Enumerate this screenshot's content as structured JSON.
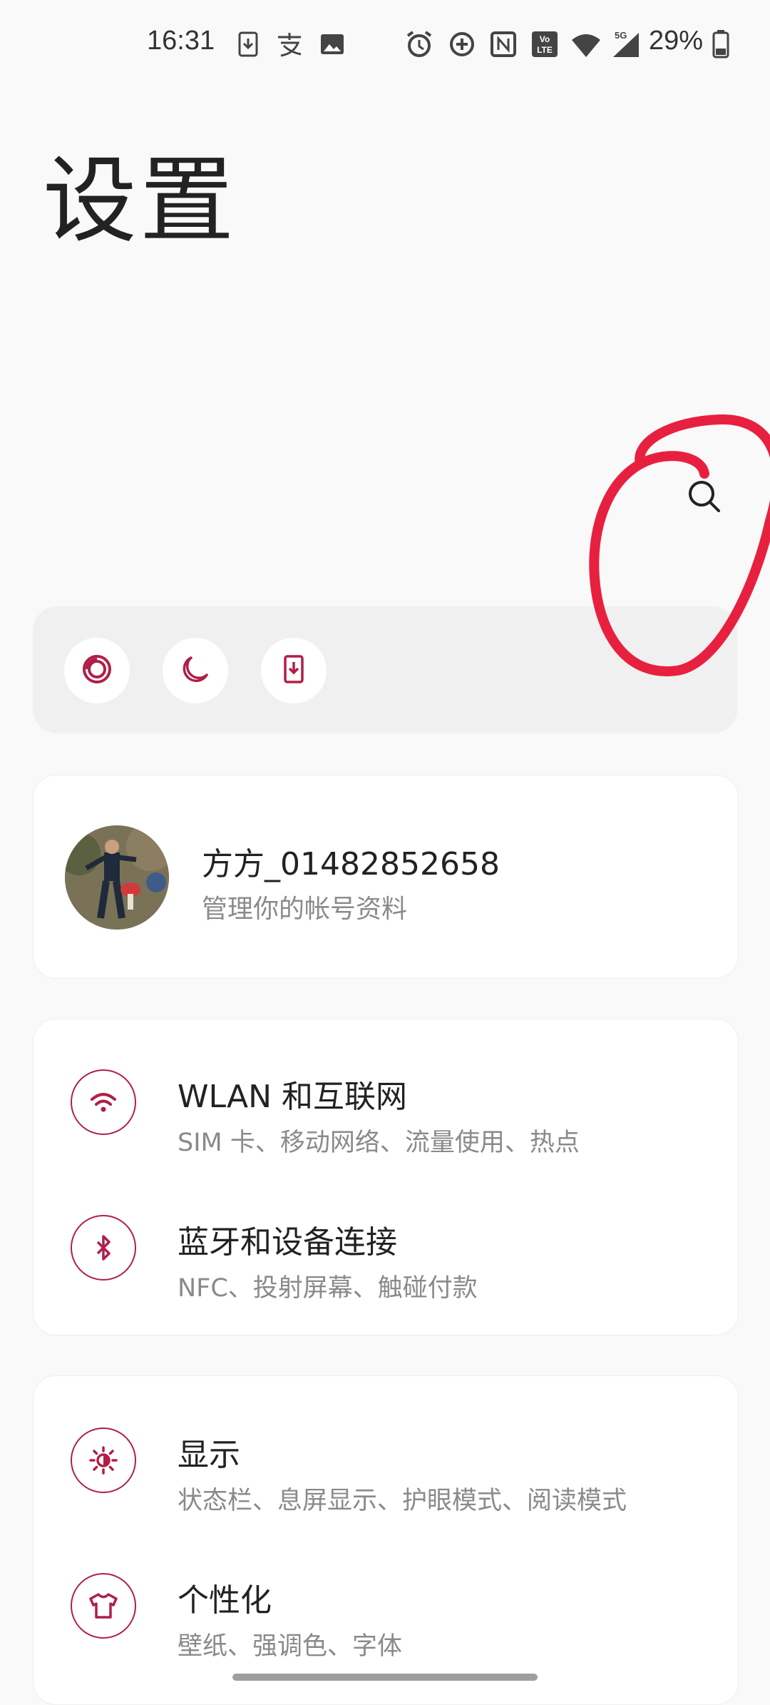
{
  "status_bar": {
    "time": "16:31",
    "battery": "29%",
    "network": "5G",
    "left_icons": [
      "download-icon",
      "alipay-icon",
      "image-icon"
    ],
    "right_icons": [
      "alarm-icon",
      "data-saver-icon",
      "nfc-icon",
      "volte-icon",
      "wifi-icon",
      "signal-icon",
      "battery-icon"
    ]
  },
  "header": {
    "title": "设置"
  },
  "search": {
    "icon": "search-icon"
  },
  "quick_actions": [
    {
      "icon": "screen-record-icon"
    },
    {
      "icon": "night-mode-icon"
    },
    {
      "icon": "phone-download-icon"
    }
  ],
  "account": {
    "name": "方方_01482852658",
    "subtitle": "管理你的帐号资料"
  },
  "groups": [
    {
      "items": [
        {
          "title": "WLAN 和互联网",
          "subtitle": "SIM 卡、移动网络、流量使用、热点",
          "icon": "wifi-icon"
        },
        {
          "title": "蓝牙和设备连接",
          "subtitle": "NFC、投射屏幕、触碰付款",
          "icon": "bluetooth-icon"
        }
      ]
    },
    {
      "items": [
        {
          "title": "显示",
          "subtitle": "状态栏、息屏显示、护眼模式、阅读模式",
          "icon": "brightness-icon"
        },
        {
          "title": "个性化",
          "subtitle": "壁纸、强调色、字体",
          "icon": "tshirt-icon"
        }
      ]
    }
  ],
  "colors": {
    "accent": "#b01f48",
    "background": "#f9f9f9",
    "annotation": "#e8203f"
  }
}
